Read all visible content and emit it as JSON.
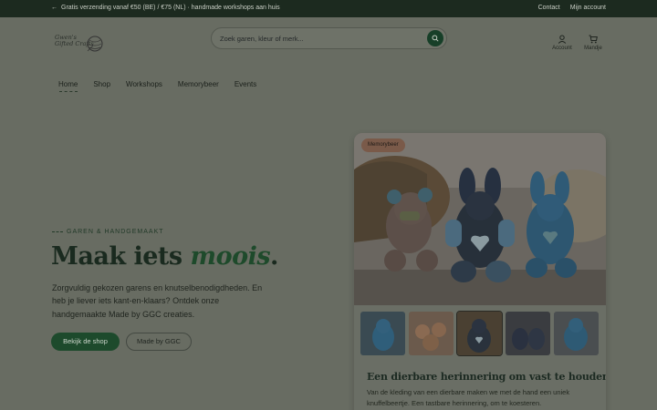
{
  "announcement": {
    "arrow": "←",
    "text": "Gratis verzending vanaf €50 (BE) / €75 (NL) · handmade workshops aan huis"
  },
  "top_links": [
    "Contact",
    "Mijn account"
  ],
  "logo": {
    "line1": "Gwen's",
    "line2": "Gifted Crafts"
  },
  "search": {
    "placeholder": "Zoek garen, kleur of merk..."
  },
  "header_icons": {
    "account_label": "Account",
    "cart_label": "Mandje"
  },
  "nav": [
    {
      "label": "Home",
      "active": true
    },
    {
      "label": "Shop"
    },
    {
      "label": "Workshops"
    },
    {
      "label": "Memorybeer"
    },
    {
      "label": "Events"
    }
  ],
  "hero": {
    "eyebrow": "GAREN & HANDGEMAAKT",
    "headline_start": "Maak iets ",
    "headline_em": "moois",
    "headline_end": ".",
    "description": "Zorgvuldig gekozen garens en knutselbenodigdheden. En heb je liever iets kant-en-klaars? Ontdek onze handgemaakte Made by GGC creaties.",
    "primary_button": "Bekijk de shop",
    "secondary_button": "Made by GGC"
  },
  "card": {
    "badge": "Memorybeer",
    "title": "Een dierbare herinnering om vast te houden",
    "text": "Van de kleding van een dierbare maken we met de hand een uniek knuffelbeertje. Een tastbare herinnering, om te koesteren."
  },
  "colors": {
    "brand_green": "#1d4a2c",
    "badge": "#7a5a49",
    "topbar": "#1c2a1f"
  }
}
